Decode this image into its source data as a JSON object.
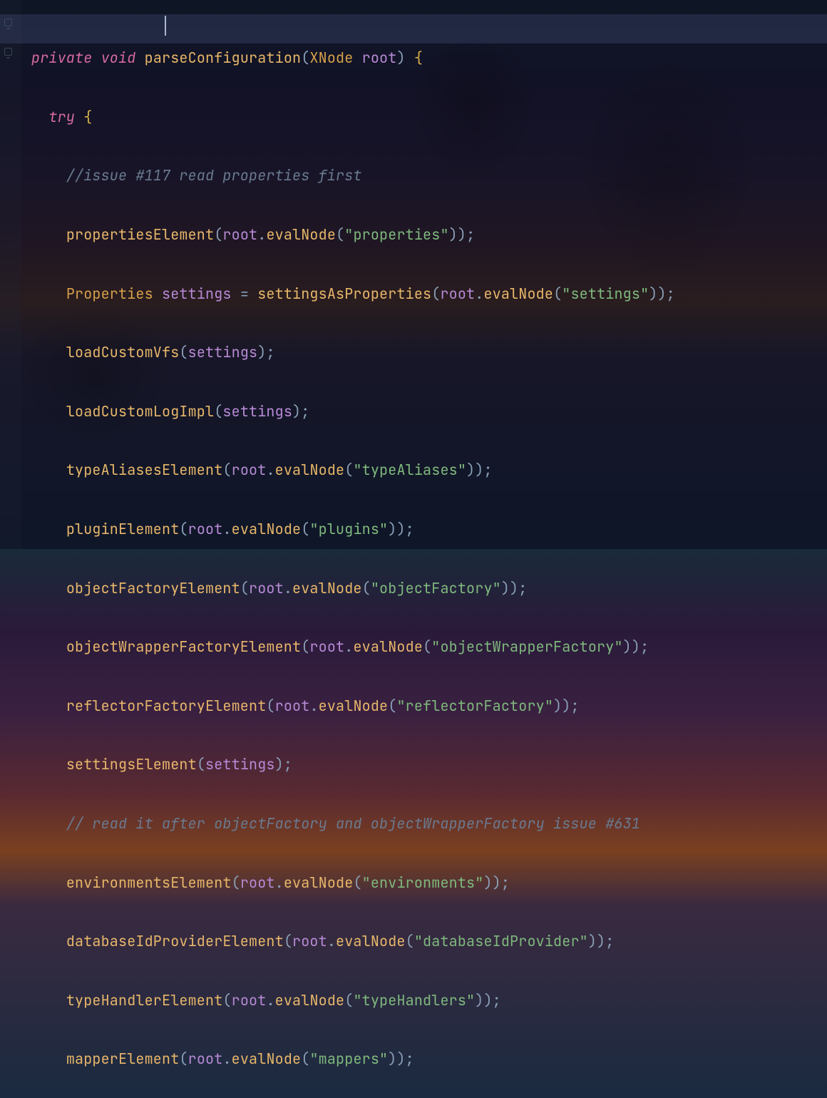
{
  "code": {
    "l1": {
      "kw1": "private",
      "kw2": "void",
      "fn": "parseConfiguration",
      "p_open": "(",
      "ty": "XNode",
      "var": "root",
      "p_close": ")",
      "br": "{"
    },
    "l2": {
      "kw": "try",
      "br": "{"
    },
    "l3": {
      "comment": "//issue #117 read properties first"
    },
    "l4": {
      "fn": "propertiesElement",
      "p1": "(",
      "var": "root",
      "dot": ".",
      "fn2": "evalNode",
      "p2": "(",
      "str": "\"properties\"",
      "p3": "))",
      "semi": ";"
    },
    "l5": {
      "ty": "Properties",
      "var1": "settings",
      "eq": "=",
      "fn": "settingsAsProperties",
      "p1": "(",
      "var2": "root",
      "dot": ".",
      "fn2": "evalNode",
      "p2": "(",
      "str": "\"settings\"",
      "p3": "))",
      "semi": ";"
    },
    "l6": {
      "fn": "loadCustomVfs",
      "p1": "(",
      "var": "settings",
      "p2": ")",
      "semi": ";"
    },
    "l7": {
      "fn": "loadCustomLogImpl",
      "p1": "(",
      "var": "settings",
      "p2": ")",
      "semi": ";"
    },
    "l8": {
      "fn": "typeAliasesElement",
      "p1": "(",
      "var": "root",
      "dot": ".",
      "fn2": "evalNode",
      "p2": "(",
      "str": "\"typeAliases\"",
      "p3": "))",
      "semi": ";"
    },
    "l9": {
      "fn": "pluginElement",
      "p1": "(",
      "var": "root",
      "dot": ".",
      "fn2": "evalNode",
      "p2": "(",
      "str": "\"plugins\"",
      "p3": "))",
      "semi": ";"
    },
    "l10": {
      "fn": "objectFactoryElement",
      "p1": "(",
      "var": "root",
      "dot": ".",
      "fn2": "evalNode",
      "p2": "(",
      "str": "\"objectFactory\"",
      "p3": "))",
      "semi": ";"
    },
    "l11": {
      "fn": "objectWrapperFactoryElement",
      "p1": "(",
      "var": "root",
      "dot": ".",
      "fn2": "evalNode",
      "p2": "(",
      "str": "\"objectWrapperFactory\"",
      "p3": "))",
      "semi": ";"
    },
    "l12": {
      "fn": "reflectorFactoryElement",
      "p1": "(",
      "var": "root",
      "dot": ".",
      "fn2": "evalNode",
      "p2": "(",
      "str": "\"reflectorFactory\"",
      "p3": "))",
      "semi": ";"
    },
    "l13": {
      "fn": "settingsElement",
      "p1": "(",
      "var": "settings",
      "p2": ")",
      "semi": ";"
    },
    "l14": {
      "comment": "// read it after objectFactory and objectWrapperFactory issue #631"
    },
    "l15": {
      "fn": "environmentsElement",
      "p1": "(",
      "var": "root",
      "dot": ".",
      "fn2": "evalNode",
      "p2": "(",
      "str": "\"environments\"",
      "p3": "))",
      "semi": ";"
    },
    "l16": {
      "fn": "databaseIdProviderElement",
      "p1": "(",
      "var": "root",
      "dot": ".",
      "fn2": "evalNode",
      "p2": "(",
      "str": "\"databaseIdProvider\"",
      "p3": "))",
      "semi": ";"
    },
    "l17": {
      "fn": "typeHandlerElement",
      "p1": "(",
      "var": "root",
      "dot": ".",
      "fn2": "evalNode",
      "p2": "(",
      "str": "\"typeHandlers\"",
      "p3": "))",
      "semi": ";"
    },
    "l18": {
      "fn": "mapperElement",
      "p1": "(",
      "var": "root",
      "dot": ".",
      "fn2": "evalNode",
      "p2": "(",
      "str": "\"mappers\"",
      "p3": "))",
      "semi": ";"
    }
  }
}
